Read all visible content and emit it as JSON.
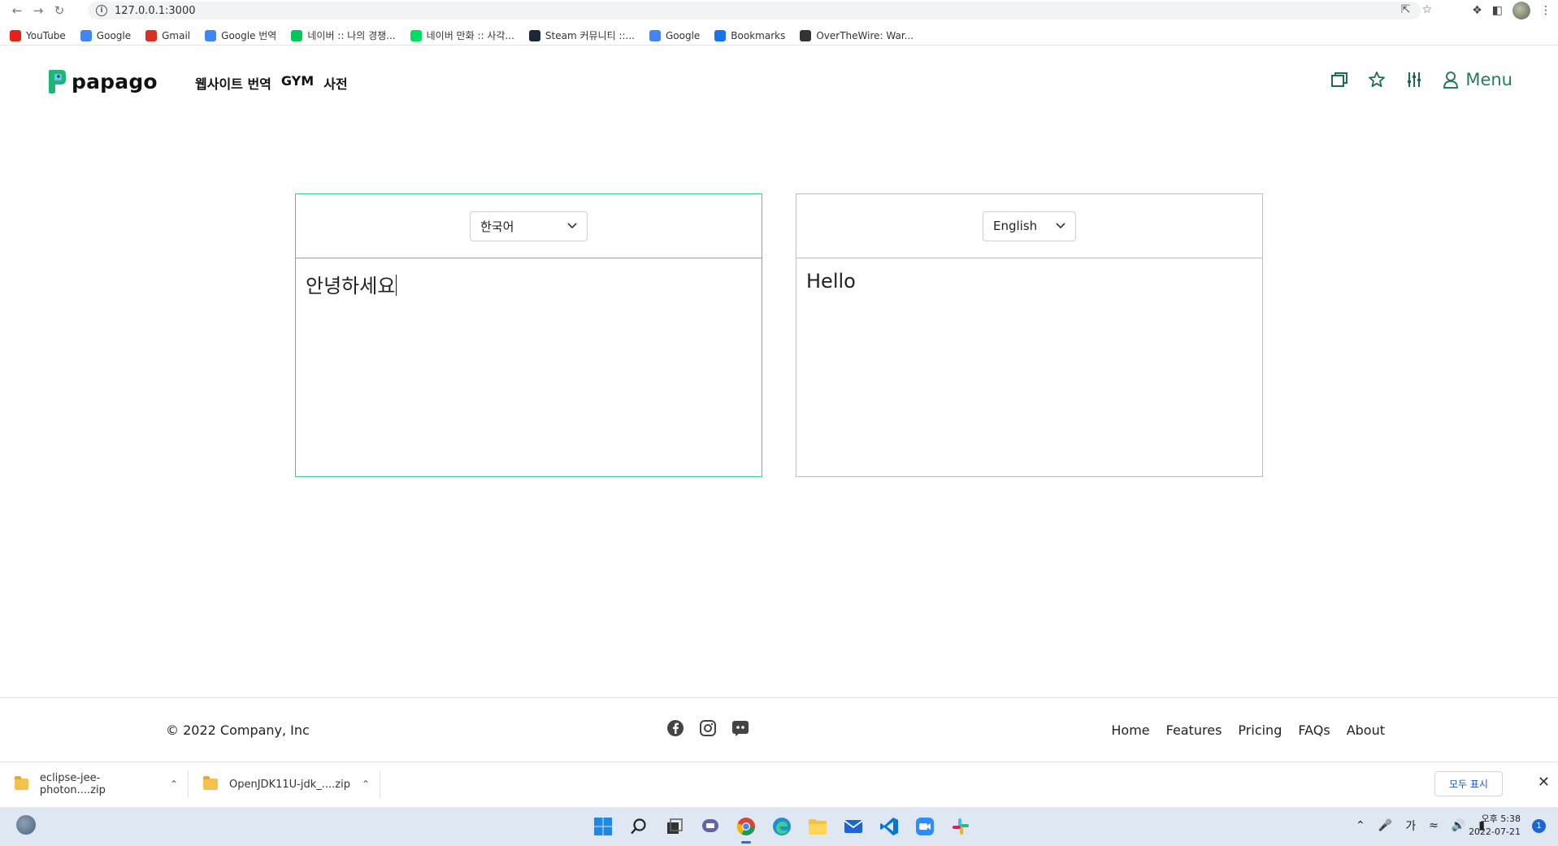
{
  "browser": {
    "url": "127.0.0.1:3000",
    "bookmarks": [
      {
        "label": "YouTube",
        "icon": "youtube-icon",
        "color": "#e62117"
      },
      {
        "label": "Google",
        "icon": "google-icon",
        "color": "#4285f4"
      },
      {
        "label": "Gmail",
        "icon": "gmail-icon",
        "color": "#d93025"
      },
      {
        "label": "Google 번역",
        "icon": "google-translate-icon",
        "color": "#4285f4"
      },
      {
        "label": "네이버 :: 나의 경쟁...",
        "icon": "naver-icon",
        "color": "#03c75a"
      },
      {
        "label": "네이버 만화 :: 사각...",
        "icon": "naver-webtoon-icon",
        "color": "#00dc64"
      },
      {
        "label": "Steam 커뮤니티 ::...",
        "icon": "steam-icon",
        "color": "#1b2838"
      },
      {
        "label": "Google",
        "icon": "google-icon",
        "color": "#4285f4"
      },
      {
        "label": "Bookmarks",
        "icon": "star-icon",
        "color": "#1a73e8"
      },
      {
        "label": "OverTheWire: War...",
        "icon": "overthewire-icon",
        "color": "#333333"
      }
    ]
  },
  "header": {
    "logo_text": "papago",
    "nav": [
      "웹사이트 번역",
      "GYM",
      "사전"
    ],
    "menu_label": "Menu",
    "accent": "#1a6a55"
  },
  "translator": {
    "source": {
      "language": "한국어",
      "text": "안녕하세요"
    },
    "target": {
      "language": "English",
      "text": "Hello"
    },
    "active_border": "#3ecf8e"
  },
  "footer": {
    "copyright": "© 2022 Company, Inc",
    "social": [
      "facebook-icon",
      "instagram-icon",
      "discord-icon"
    ],
    "links": [
      "Home",
      "Features",
      "Pricing",
      "FAQs",
      "About"
    ]
  },
  "downloads": {
    "items": [
      "eclipse-jee-photon....zip",
      "OpenJDK11U-jdk_....zip"
    ],
    "show_all": "모두 표시"
  },
  "taskbar": {
    "ime": "가",
    "time": "오후 5:38",
    "date": "2022-07-21",
    "notifications": "1"
  }
}
